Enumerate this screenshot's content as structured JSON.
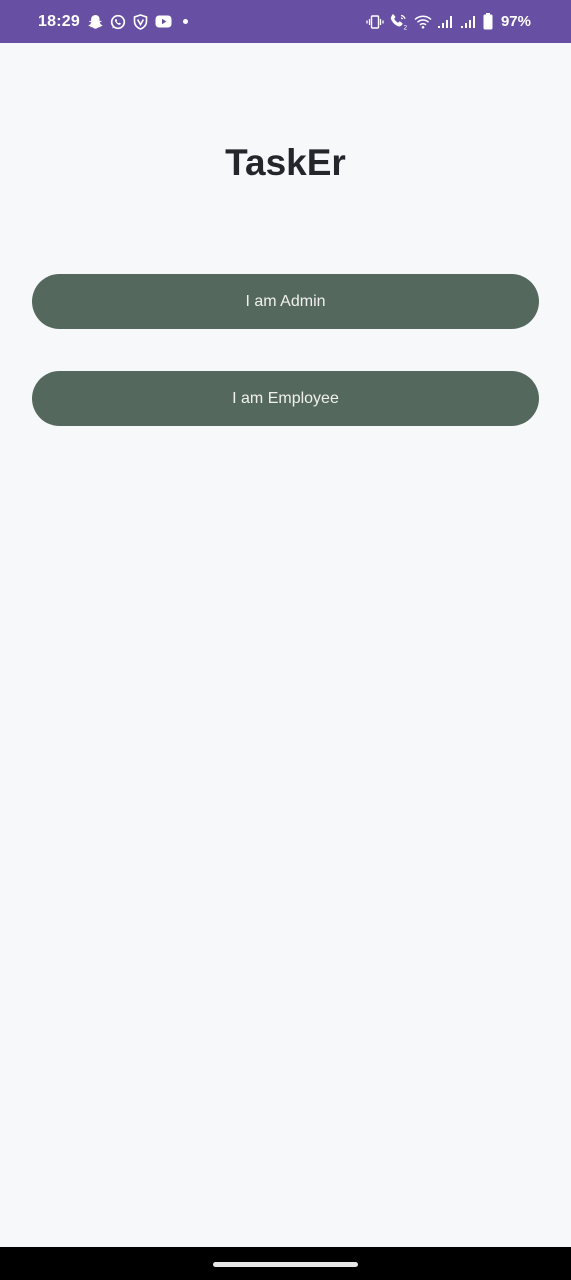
{
  "status_bar": {
    "time": "18:29",
    "battery_percent": "97%",
    "left_icons": [
      "snapchat-icon",
      "whatsapp-icon",
      "vpn-shield-icon",
      "youtube-icon",
      "more-notifications-dot-icon"
    ],
    "right_icons": [
      "vibrate-icon",
      "wifi-calling-icon",
      "wifi-icon",
      "signal-sim1-icon",
      "signal-sim2-icon",
      "battery-icon"
    ],
    "background_color": "#6750a4"
  },
  "app": {
    "title": "TaskEr"
  },
  "buttons": {
    "admin_label": "I am Admin",
    "employee_label": "I am Employee",
    "color": "#55685e"
  }
}
